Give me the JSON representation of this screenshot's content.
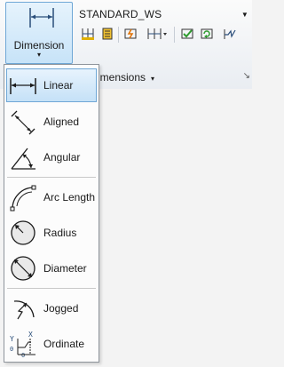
{
  "ribbon": {
    "dimension_button": {
      "label": "Dimension",
      "caret": "▾"
    },
    "dim_style": {
      "value": "STANDARD_WS"
    },
    "panel_title": "imensions",
    "panel_arrow": "▾",
    "pin": "↘",
    "tool_icons": [
      "dim-continue-icon",
      "dim-space-icon",
      "dim-break-icon",
      "dim-linear-baseline-icon",
      "dim-inspect-icon",
      "dim-update-icon",
      "dim-jogged-linear-icon"
    ]
  },
  "menu": {
    "items": [
      {
        "label": "Linear",
        "icon": "linear-dimension-icon",
        "active": true
      },
      {
        "label": "Aligned",
        "icon": "aligned-dimension-icon"
      },
      {
        "label": "Angular",
        "icon": "angular-dimension-icon"
      },
      {
        "label": "Arc Length",
        "icon": "arc-length-dimension-icon"
      },
      {
        "label": "Radius",
        "icon": "radius-dimension-icon"
      },
      {
        "label": "Diameter",
        "icon": "diameter-dimension-icon"
      },
      {
        "label": "Jogged",
        "icon": "jogged-dimension-icon"
      },
      {
        "label": "Ordinate",
        "icon": "ordinate-dimension-icon"
      }
    ]
  },
  "colors": {
    "accent": "#6fa7d6",
    "highlight": "#c5e1f7"
  }
}
